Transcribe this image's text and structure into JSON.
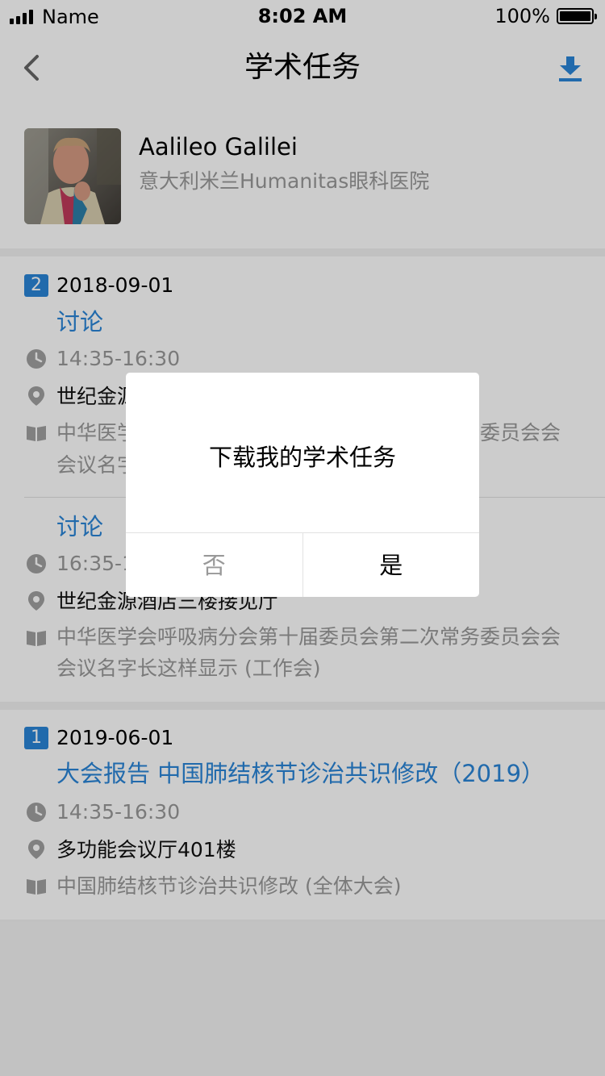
{
  "status_bar": {
    "carrier": "Name",
    "time": "8:02 AM",
    "battery": "100%"
  },
  "nav": {
    "title": "学术任务",
    "back_icon": "chevron-left-icon",
    "download_icon": "download-icon"
  },
  "profile": {
    "name": "Aalileo Galilei",
    "hospital": "意大利米兰Humanitas眼科医院"
  },
  "tasks": [
    {
      "badge": "2",
      "date": "2018-09-01",
      "items": [
        {
          "title": "讨论",
          "time": "14:35-16:30",
          "place": "世纪金源酒店三楼接见厅",
          "meeting": "中华医学会呼吸病分会第十届委员会第二次常务委员会会",
          "meeting_line2": "会议名字长这样显示 (工作会)"
        },
        {
          "title": "讨论",
          "time": "16:35-18:30",
          "place": "世纪金源酒店三楼接见厅",
          "meeting": "中华医学会呼吸病分会第十届委员会第二次常务委员会会",
          "meeting_line2": "会议名字长这样显示 (工作会)"
        }
      ]
    },
    {
      "badge": "1",
      "date": "2019-06-01",
      "items": [
        {
          "title": "大会报告 中国肺结核节诊治共识修改（2019）",
          "time": "14:35-16:30",
          "place": "多功能会议厅401楼",
          "meeting": "中国肺结核节诊治共识修改 (全体大会)"
        }
      ]
    }
  ],
  "dialog": {
    "message": "下载我的学术任务",
    "no_label": "否",
    "yes_label": "是"
  },
  "colors": {
    "accent": "#2a85d8",
    "muted": "#999999"
  }
}
